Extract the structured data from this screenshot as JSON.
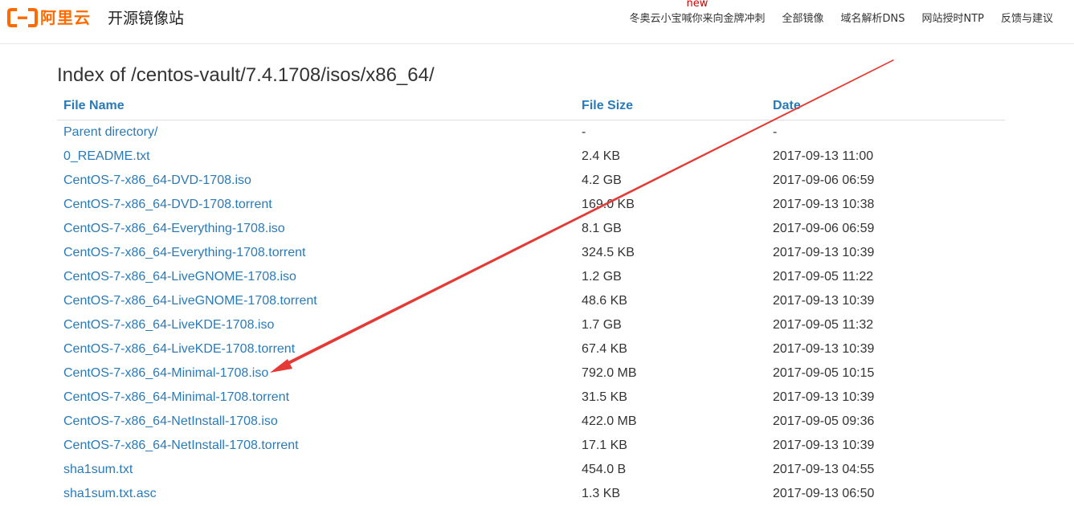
{
  "header": {
    "logo_text": "阿里云",
    "site_title": "开源镜像站",
    "brand_color": "#ff6a00",
    "nav": [
      {
        "label": "冬奥云小宝喊你来向金牌冲刺",
        "badge": "new"
      },
      {
        "label": "全部镜像"
      },
      {
        "label": "域名解析DNS"
      },
      {
        "label": "网站授时NTP"
      },
      {
        "label": "反馈与建议"
      }
    ]
  },
  "page": {
    "title": "Index of /centos-vault/7.4.1708/isos/x86_64/"
  },
  "table": {
    "headers": {
      "name": "File Name",
      "size": "File Size",
      "date": "Date"
    },
    "rows": [
      {
        "name": "Parent directory/",
        "size": "-",
        "date": "-"
      },
      {
        "name": "0_README.txt",
        "size": "2.4 KB",
        "date": "2017-09-13 11:00"
      },
      {
        "name": "CentOS-7-x86_64-DVD-1708.iso",
        "size": "4.2 GB",
        "date": "2017-09-06 06:59"
      },
      {
        "name": "CentOS-7-x86_64-DVD-1708.torrent",
        "size": "169.0 KB",
        "date": "2017-09-13 10:38"
      },
      {
        "name": "CentOS-7-x86_64-Everything-1708.iso",
        "size": "8.1 GB",
        "date": "2017-09-06 06:59"
      },
      {
        "name": "CentOS-7-x86_64-Everything-1708.torrent",
        "size": "324.5 KB",
        "date": "2017-09-13 10:39"
      },
      {
        "name": "CentOS-7-x86_64-LiveGNOME-1708.iso",
        "size": "1.2 GB",
        "date": "2017-09-05 11:22"
      },
      {
        "name": "CentOS-7-x86_64-LiveGNOME-1708.torrent",
        "size": "48.6 KB",
        "date": "2017-09-13 10:39"
      },
      {
        "name": "CentOS-7-x86_64-LiveKDE-1708.iso",
        "size": "1.7 GB",
        "date": "2017-09-05 11:32"
      },
      {
        "name": "CentOS-7-x86_64-LiveKDE-1708.torrent",
        "size": "67.4 KB",
        "date": "2017-09-13 10:39"
      },
      {
        "name": "CentOS-7-x86_64-Minimal-1708.iso",
        "size": "792.0 MB",
        "date": "2017-09-05 10:15"
      },
      {
        "name": "CentOS-7-x86_64-Minimal-1708.torrent",
        "size": "31.5 KB",
        "date": "2017-09-13 10:39"
      },
      {
        "name": "CentOS-7-x86_64-NetInstall-1708.iso",
        "size": "422.0 MB",
        "date": "2017-09-05 09:36"
      },
      {
        "name": "CentOS-7-x86_64-NetInstall-1708.torrent",
        "size": "17.1 KB",
        "date": "2017-09-13 10:39"
      },
      {
        "name": "sha1sum.txt",
        "size": "454.0 B",
        "date": "2017-09-13 04:55"
      },
      {
        "name": "sha1sum.txt.asc",
        "size": "1.3 KB",
        "date": "2017-09-13 06:50"
      }
    ]
  },
  "colors": {
    "link": "#2a7ab8",
    "new_badge": "#d50000",
    "annotation_arrow": "#e53935"
  }
}
